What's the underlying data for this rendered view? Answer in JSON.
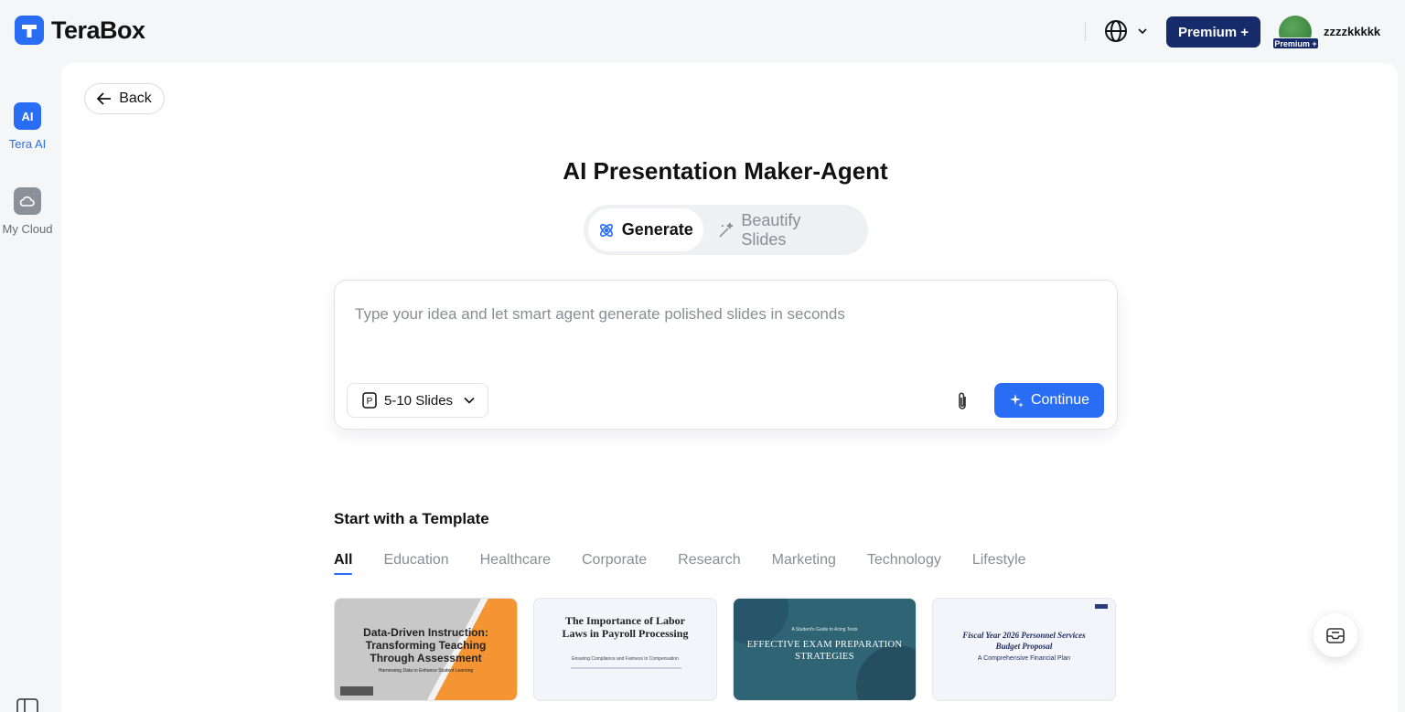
{
  "header": {
    "logo_text": "TeraBox",
    "premium_label": "Premium +",
    "avatar_badge": "Premium +",
    "username": "zzzzkkkkk",
    "brand_color": "#2a6df5",
    "premium_color": "#172b6b"
  },
  "sidebar": {
    "items": [
      {
        "label": "Tera AI",
        "icon": "ai-icon",
        "active": true
      },
      {
        "label": "My Cloud",
        "icon": "cloud-icon",
        "active": false
      }
    ]
  },
  "main": {
    "back_label": "Back",
    "title": "AI Presentation Maker-Agent",
    "modes": [
      {
        "label": "Generate",
        "icon": "atom-icon",
        "active": true
      },
      {
        "label": "Beautify Slides",
        "icon": "magic-wand-icon",
        "active": false
      }
    ],
    "prompt": {
      "placeholder": "Type your idea and let smart agent generate polished slides in seconds",
      "value": "",
      "slides_option": "5-10 Slides",
      "continue_label": "Continue"
    },
    "templates": {
      "heading": "Start with a Template",
      "categories": [
        "All",
        "Education",
        "Healthcare",
        "Corporate",
        "Research",
        "Marketing",
        "Technology",
        "Lifestyle"
      ],
      "active_category": "All",
      "cards": [
        {
          "title": "Data-Driven Instruction: Transforming Teaching Through Assessment",
          "subtitle": "Harnessing Data to Enhance Student Learning"
        },
        {
          "title": "The Importance of Labor Laws in Payroll Processing",
          "subtitle": "Ensuring Compliance and Fairness in Compensation"
        },
        {
          "title": "EFFECTIVE EXAM PREPARATION STRATEGIES",
          "subtitle": "A Student's Guide to Acing Tests"
        },
        {
          "title": "Fiscal Year 2026 Personnel Services Budget Proposal",
          "subtitle": "A Comprehensive Financial Plan"
        }
      ]
    }
  }
}
